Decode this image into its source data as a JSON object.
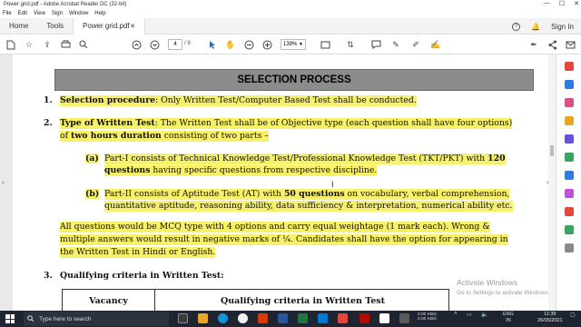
{
  "window": {
    "title": "Power grid.pdf - Adobe Acrobat Reader DC (32-bit)",
    "controls": [
      "—",
      "☐",
      "✕"
    ]
  },
  "menu": [
    "File",
    "Edit",
    "View",
    "Sign",
    "Window",
    "Help"
  ],
  "tabs": {
    "home": "Home",
    "tools": "Tools",
    "document": "Power grid.pdf",
    "sign_in": "Sign In"
  },
  "toolbar": {
    "current_page": "4",
    "page_count": "/ 9",
    "zoom": "139%"
  },
  "document": {
    "heading": "SELECTION PROCESS",
    "item1": {
      "num": "1.",
      "label": "Selection procedure",
      "text": ": Only Written Test/Computer Based Test shall be conducted."
    },
    "item2": {
      "num": "2.",
      "label": "Type of Written Test",
      "text_line1": ": The Written Test shall be of Objective type (each question shall have four options)",
      "text_line2_pre": "of ",
      "text_line2_bold": "two hours duration",
      "text_line2_post": " consisting of two parts –"
    },
    "part_a": {
      "label": "(a)",
      "line1_pre": "Part-I consists of Technical Knowledge Test/Professional Knowledge Test (TKT/PKT) with ",
      "line1_bold": "120",
      "line2_bold": "questions",
      "line2_post": " having specific questions from respective discipline."
    },
    "part_b": {
      "label": "(b)",
      "line1_pre": "Part-II consists of Aptitude Test (AT) with ",
      "line1_bold": "50 questions",
      "line1_post": " on vocabulary, verbal comprehension,",
      "line2": "quantitative aptitude, reasoning ability, data sufficiency & interpretation, numerical ability etc."
    },
    "mcq_para": {
      "line1": "All questions would be MCQ type with 4 options and carry equal weightage (1 mark each).  Wrong &",
      "line2": "multiple answers would result in negative marks of ¼.  Candidates shall have the option for appearing in",
      "line3": "the Written Test in Hindi or English."
    },
    "item3": {
      "num": "3.",
      "label": "Qualifying criteria in Written Test:"
    },
    "table": {
      "col1": "Vacancy",
      "col2": "Qualifying criteria in Written Test"
    }
  },
  "watermark": {
    "title": "Activate Windows",
    "sub": "Go to Settings to activate Windows."
  },
  "taskbar": {
    "search_placeholder": "Type here to search",
    "net_up": "0.00 KB/s",
    "net_down": "0.00 KB/s",
    "lang": "ENG",
    "region": "IN",
    "time": "11:39",
    "date": "26/05/2021"
  },
  "colors": {
    "highlight": "#f6f06a",
    "heading_bg": "#8c8c8c",
    "taskbar_bg": "#1e2530"
  }
}
